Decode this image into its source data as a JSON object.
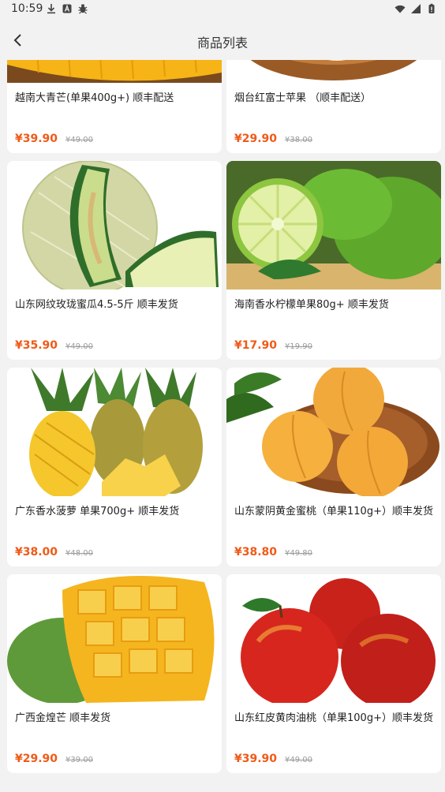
{
  "status_bar": {
    "time": "10:59",
    "left_icons": [
      "download-icon",
      "a-badge-icon",
      "bug-icon"
    ],
    "right_icons": [
      "wifi-icon",
      "signal-icon",
      "battery-icon"
    ]
  },
  "header": {
    "title": "商品列表",
    "back_icon": "chevron-left-icon"
  },
  "colors": {
    "price": "#ef5a18",
    "original_price": "#9a9a9a",
    "background": "#f2f2f2",
    "card": "#ffffff"
  },
  "products": [
    {
      "name": "越南大青芒(单果400g+) 顺丰配送",
      "price": "¥39.90",
      "original_price": "¥49.00",
      "image": "mango-cut-icon"
    },
    {
      "name": "烟台红富士苹果 （顺丰配送）",
      "price": "¥29.90",
      "original_price": "¥38.00",
      "image": "apple-bowl-icon"
    },
    {
      "name": "山东网纹玫珑蜜瓜4.5-5斤 顺丰发货",
      "price": "¥35.90",
      "original_price": "¥49.00",
      "image": "melon-icon"
    },
    {
      "name": "海南香水柠檬单果80g+ 顺丰发货",
      "price": "¥17.90",
      "original_price": "¥19.90",
      "image": "lime-icon"
    },
    {
      "name": "广东香水菠萝 单果700g+ 顺丰发货",
      "price": "¥38.00",
      "original_price": "¥48.00",
      "image": "pineapple-icon"
    },
    {
      "name": "山东蒙阴黄金蜜桃（单果110g+）顺丰发货",
      "price": "¥38.80",
      "original_price": "¥49.80",
      "image": "yellow-peach-icon"
    },
    {
      "name": "广西金煌芒 顺丰发货",
      "price": "¥29.90",
      "original_price": "¥39.00",
      "image": "green-mango-icon"
    },
    {
      "name": "山东红皮黄肉油桃（单果100g+）顺丰发货",
      "price": "¥39.90",
      "original_price": "¥49.00",
      "image": "nectarine-icon"
    }
  ]
}
